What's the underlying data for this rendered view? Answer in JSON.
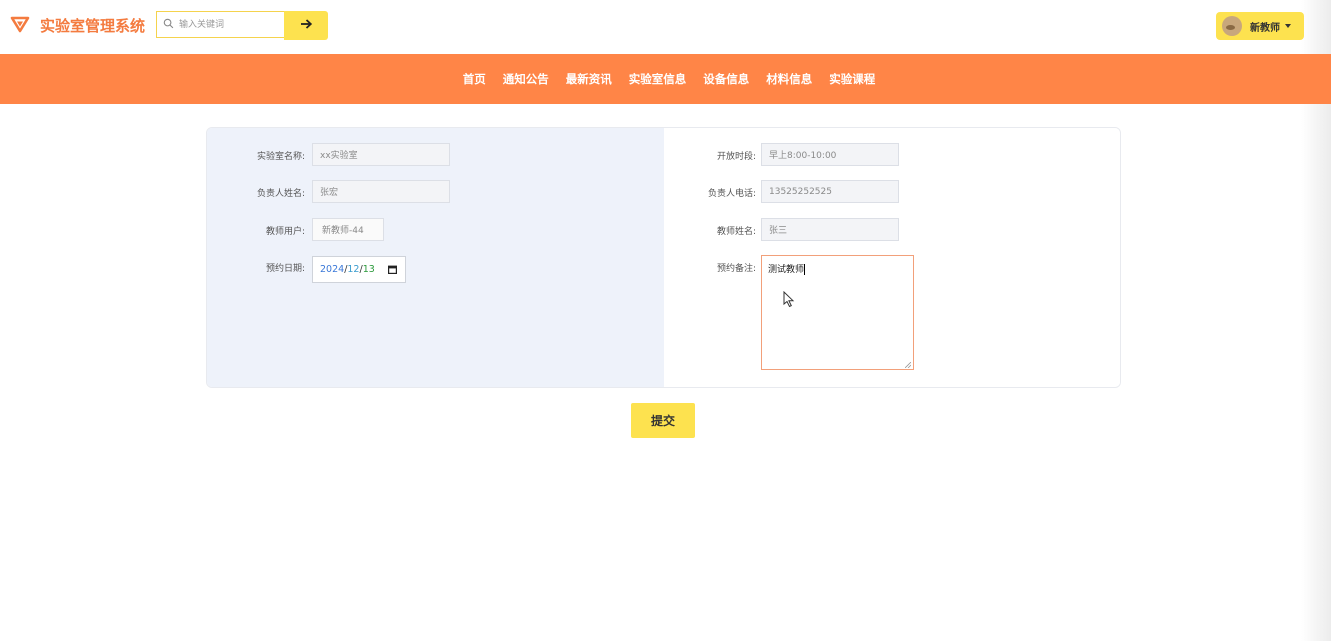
{
  "header": {
    "app_title": "实验室管理系统",
    "logo_icon": "triangle-logo-icon",
    "search": {
      "placeholder": "输入关键词",
      "value": "",
      "icon": "search-icon",
      "button_icon": "arrow-right-icon"
    },
    "user": {
      "name": "新教师",
      "avatar_icon": "avatar-image",
      "dropdown_icon": "caret-down-icon"
    }
  },
  "nav": {
    "items": [
      {
        "label": "首页"
      },
      {
        "label": "通知公告"
      },
      {
        "label": "最新资讯"
      },
      {
        "label": "实验室信息"
      },
      {
        "label": "设备信息"
      },
      {
        "label": "材料信息"
      },
      {
        "label": "实验课程"
      }
    ]
  },
  "form": {
    "left": {
      "lab_name": {
        "label": "实验室名称:",
        "value": "xx实验室"
      },
      "manager_name": {
        "label": "负责人姓名:",
        "value": "张宏"
      },
      "teacher_user": {
        "label": "教师用户:",
        "value": "新教师-44"
      },
      "reserve_date": {
        "label": "预约日期:",
        "year": "2024",
        "month": "12",
        "day": "13",
        "sep": "/"
      }
    },
    "right": {
      "open_time": {
        "label": "开放时段:",
        "value": "早上8:00-10:00"
      },
      "manager_phone": {
        "label": "负责人电话:",
        "value": "13525252525"
      },
      "teacher_name": {
        "label": "教师姓名:",
        "value": "张三"
      },
      "remark": {
        "label": "预约备注:",
        "value": "测试教师"
      }
    },
    "submit_label": "提交"
  },
  "colors": {
    "brand_orange": "#f47b3f",
    "nav_orange": "#ff8547",
    "accent_yellow": "#fde24f",
    "panel_left_bg": "#eef2fa"
  }
}
